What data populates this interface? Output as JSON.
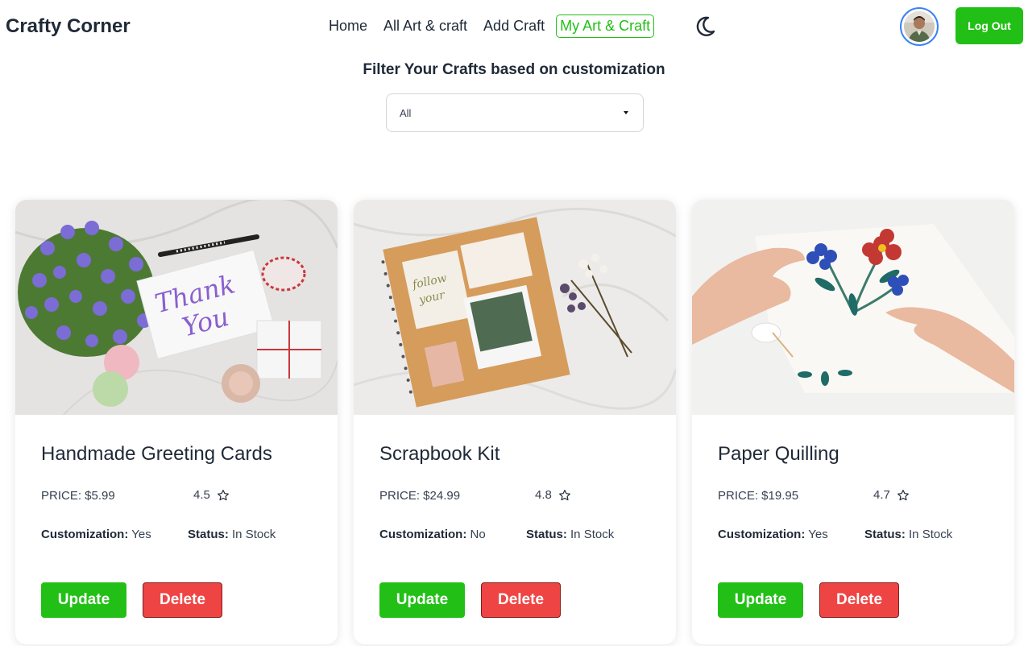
{
  "navbar": {
    "brand": "Crafty Corner",
    "links": [
      "Home",
      "All Art & craft",
      "Add Craft",
      "My Art & Craft"
    ],
    "active_link": "My Art & Craft",
    "logout_label": "Log Out",
    "accent_color": "#22c016"
  },
  "filter": {
    "title": "Filter Your Crafts based on customization",
    "selected": "All"
  },
  "labels": {
    "customization": "Customization:",
    "status": "Status:",
    "update": "Update",
    "delete": "Delete"
  },
  "cards": [
    {
      "title": "Handmade Greeting Cards",
      "price": "PRICE: $5.99",
      "rating": "4.5",
      "customization": "Yes",
      "status": "In Stock"
    },
    {
      "title": "Scrapbook Kit",
      "price": "PRICE: $24.99",
      "rating": "4.8",
      "customization": "No",
      "status": "In Stock"
    },
    {
      "title": "Paper Quilling",
      "price": "PRICE: $19.95",
      "rating": "4.7",
      "customization": "Yes",
      "status": "In Stock"
    }
  ],
  "colors": {
    "update": "#22c016",
    "delete": "#ef4444",
    "avatar_ring": "#3b82f6"
  }
}
